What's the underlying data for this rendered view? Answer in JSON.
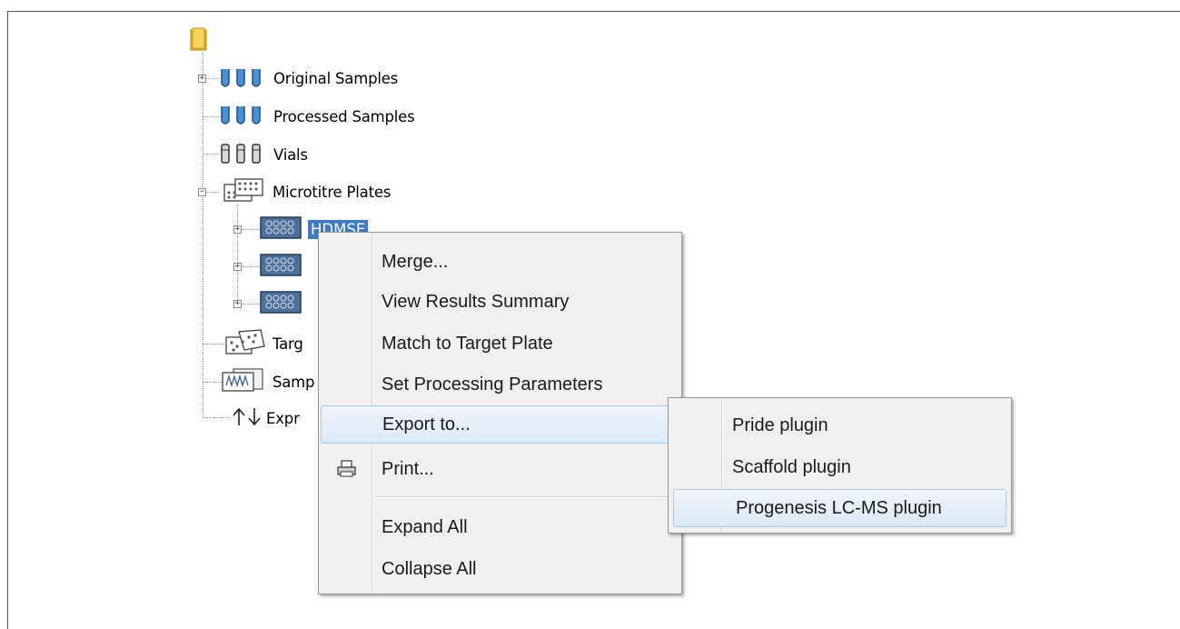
{
  "tree": {
    "items": [
      {
        "label": "Original Samples",
        "icon": "sample-tubes-icon",
        "expander": "+"
      },
      {
        "label": "Processed Samples",
        "icon": "sample-tubes-icon"
      },
      {
        "label": "Vials",
        "icon": "vials-icon"
      },
      {
        "label": "Microtitre Plates",
        "icon": "microtitre-plate-icon",
        "expander": "−"
      },
      {
        "label": "HDMSE",
        "icon": "plate-icon",
        "expander": "+",
        "selected": true
      },
      {
        "label": "",
        "icon": "plate-icon",
        "expander": "+"
      },
      {
        "label": "",
        "icon": "plate-icon",
        "expander": "+"
      },
      {
        "label": "Targ",
        "icon": "target-plate-icon"
      },
      {
        "label": "Samp",
        "icon": "sample-list-icon"
      },
      {
        "label": "Expr",
        "icon": "export-arrows-icon"
      }
    ]
  },
  "context_menu": {
    "items": [
      {
        "label": "Merge..."
      },
      {
        "label": "View Results Summary"
      },
      {
        "label": "Match to Target Plate"
      },
      {
        "label": "Set Processing Parameters"
      },
      {
        "label": "Export to...",
        "has_submenu": true,
        "highlighted": true
      },
      {
        "label": "Print...",
        "icon": "printer-icon"
      },
      {
        "label": "Expand All"
      },
      {
        "label": "Collapse All"
      }
    ]
  },
  "submenu": {
    "items": [
      {
        "label": "Pride plugin"
      },
      {
        "label": "Scaffold plugin"
      },
      {
        "label": "Progenesis LC-MS plugin",
        "highlighted": true
      }
    ]
  },
  "colors": {
    "selection": "#3d7ac8",
    "menu_bg": "#f0f0f0",
    "highlight_border": "#a8c8ec"
  }
}
